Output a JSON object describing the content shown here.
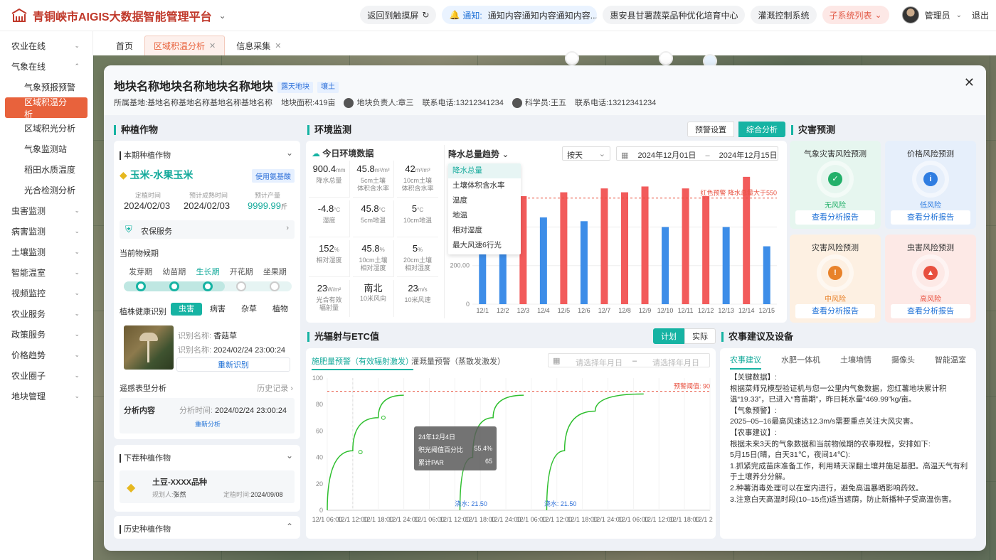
{
  "header": {
    "app_title": "青铜峡市AIGIS大数据智能管理平台",
    "back_label": "返回到触摸屏",
    "notice_label": "通知:",
    "notice_text": "通知内容通知内容通知内容...",
    "org": "惠安县甘薯蔬菜品种优化培育中心",
    "irrigation": "灌溉控制系统",
    "subsystem": "子系统列表",
    "user": "管理员",
    "logout": "退出"
  },
  "sidebar": {
    "items": [
      {
        "label": "农业在线",
        "chev": "⌄"
      },
      {
        "label": "气象在线",
        "chev": "⌃"
      },
      {
        "label": "气象预报预警",
        "sub": true
      },
      {
        "label": "区域积温分析",
        "sub": true,
        "active": true
      },
      {
        "label": "区域积光分析",
        "sub": true
      },
      {
        "label": "气象监测站",
        "sub": true
      },
      {
        "label": "稻田水质温度",
        "sub": true
      },
      {
        "label": "光合检测分析",
        "sub": true
      },
      {
        "label": "虫害监测",
        "chev": "⌄"
      },
      {
        "label": "病害监测",
        "chev": "⌄"
      },
      {
        "label": "土壤监测",
        "chev": "⌄"
      },
      {
        "label": "智能温室",
        "chev": "⌄"
      },
      {
        "label": "视频监控",
        "chev": "⌄"
      },
      {
        "label": "农业服务",
        "chev": "⌄"
      },
      {
        "label": "政策服务",
        "chev": "⌄"
      },
      {
        "label": "价格趋势",
        "chev": "⌄"
      },
      {
        "label": "农业圈子",
        "chev": "⌄"
      },
      {
        "label": "地块管理",
        "chev": "⌄"
      }
    ]
  },
  "tabs": [
    {
      "label": "首页"
    },
    {
      "label": "区域积温分析",
      "active": true,
      "close": "✕"
    },
    {
      "label": "信息采集",
      "close": "✕"
    }
  ],
  "modal": {
    "title": "地块名称地块名称地块名称地块",
    "tag1": "露天地块",
    "tag2": "壤土",
    "base_label": "所属基地:",
    "base_value": "基地名称基地名称基地名称基地名称",
    "area_label": "地块面积:",
    "area_value": "419亩",
    "owner_label": "地块负责人:",
    "owner_value": "章三",
    "phone_label": "联系电话:",
    "phone_value": "13212341234",
    "sci_label": "科学员:",
    "sci_value": "王五",
    "phone2_label": "联系电话:",
    "phone2_value": "13212341234",
    "close": "✕"
  },
  "crop": {
    "section": "种植作物",
    "current_title": "本期种植作物",
    "name": "玉米-水果玉米",
    "fert_btn": "使用氨基酸",
    "plant_time_label": "定植时间",
    "plant_time": "2024/02/03",
    "harvest_label": "预计成熟时间",
    "harvest": "2024/02/03",
    "yield_label": "预计产量",
    "yield": "9999.99",
    "yield_unit": "斤",
    "service": "农保服务",
    "phenology_title": "当前物候期",
    "phases": [
      "发芽期",
      "幼苗期",
      "生长期",
      "开花期",
      "坐果期"
    ],
    "current_phase_index": 2,
    "health_title": "植株健康识别",
    "health_tabs": [
      "虫害",
      "病害",
      "杂草",
      "植物"
    ],
    "id_name_label": "识别名称:",
    "id_name": "香菇草",
    "id_time_label": "识别名称:",
    "id_time": "2024/02/24 23:00:24",
    "reidentify": "重新识别",
    "remote_title": "遥感表型分析",
    "history": "历史记录",
    "analysis_label": "分析内容",
    "analysis_time_label": "分析时间:",
    "analysis_time": "2024/02/24 23:00:24",
    "reanalyze": "重新分析",
    "next_title": "下茬种植作物",
    "next_name": "土豆-XXXX品种",
    "planner_label": "规划人:",
    "planner": "张然",
    "next_time_label": "定植时间:",
    "next_time": "2024/09/08",
    "history_title": "历史种植作物"
  },
  "env": {
    "section": "环境监测",
    "warn_btn": "预警设置",
    "analysis_btn": "综合分析",
    "today": "今日环境数据",
    "cells": [
      {
        "v": "900.4",
        "u": "mm",
        "l1": "降水总量",
        "l2": ""
      },
      {
        "v": "45.8",
        "u": "m³/m³",
        "l1": "5cm土壤",
        "l2": "体积含水率"
      },
      {
        "v": "42",
        "u": "m³/m³",
        "l1": "10cm土壤",
        "l2": "体积含水率"
      },
      {
        "v": "-4.8",
        "u": "°C",
        "l1": "湿度",
        "l2": ""
      },
      {
        "v": "45.8",
        "u": "°C",
        "l1": "5cm地温",
        "l2": ""
      },
      {
        "v": "5",
        "u": "°C",
        "l1": "10cm地温",
        "l2": ""
      },
      {
        "v": "152",
        "u": "%",
        "l1": "相对湿度",
        "l2": ""
      },
      {
        "v": "45.8",
        "u": "%",
        "l1": "10cm土壤",
        "l2": "相对湿度"
      },
      {
        "v": "5",
        "u": "%",
        "l1": "20cm土壤",
        "l2": "相对湿度"
      },
      {
        "v": "23",
        "u": "W/m²",
        "l1": "光合有效",
        "l2": "辐射量"
      },
      {
        "v": "南北",
        "u": "",
        "l1": "10米风向",
        "l2": ""
      },
      {
        "v": "23",
        "u": "m/s",
        "l1": "10米风速",
        "l2": ""
      }
    ],
    "trend_title": "降水总量趋势",
    "period": "按天",
    "date_from": "2024年12月01日",
    "date_sep": "–",
    "date_to": "2024年12月15日",
    "dropdown": [
      "降水总量",
      "土壤体积含水率",
      "温度",
      "地温",
      "相对湿度",
      "最大风速6行光"
    ]
  },
  "chart_data": [
    {
      "type": "bar",
      "categories": [
        "12/1",
        "12/2",
        "12/3",
        "12/4",
        "12/5",
        "12/6",
        "12/7",
        "12/8",
        "12/9",
        "12/10",
        "12/11",
        "12/12",
        "12/13",
        "12/14",
        "12/15"
      ],
      "values": [
        410,
        410,
        560,
        450,
        580,
        430,
        600,
        580,
        610,
        400,
        600,
        560,
        400,
        660,
        300
      ],
      "colors": [
        "#3d8de8",
        "#3d8de8",
        "#f25b5b",
        "#3d8de8",
        "#f25b5b",
        "#3d8de8",
        "#f25b5b",
        "#f25b5b",
        "#f25b5b",
        "#3d8de8",
        "#f25b5b",
        "#f25b5b",
        "#3d8de8",
        "#f25b5b",
        "#3d8de8"
      ],
      "yticks": [
        "0",
        "200.00",
        "400.00"
      ],
      "ylim": [
        0,
        700
      ],
      "threshold": 550,
      "threshold_label": "红色预警 降水总量大于550"
    },
    {
      "type": "line",
      "series": [
        {
          "points": [
            [
              0,
              0
            ],
            [
              1,
              45
            ],
            [
              2,
              70
            ],
            [
              3,
              87
            ]
          ]
        },
        {
          "points": [
            [
              5.2,
              0
            ],
            [
              5.7,
              40
            ],
            [
              6.5,
              70
            ],
            [
              7.7,
              87
            ]
          ]
        },
        {
          "points": [
            [
              8.6,
              0
            ],
            [
              9.3,
              45
            ],
            [
              10.5,
              75
            ],
            [
              12.4,
              88
            ]
          ]
        }
      ],
      "markers": [
        [
          1.3,
          44
        ],
        [
          2.2,
          70
        ]
      ],
      "xticks": [
        "12/1 06:00",
        "12/1 12:00",
        "12/1 18:00",
        "12/1 24:00",
        "12/1 06:00",
        "12/1 12:00",
        "12/1 18:00",
        "12/1 24:00",
        "12/1 06:00",
        "12/1 12:00",
        "12/1 18:00",
        "12/1 24:00",
        "12/1 06:00",
        "12/1 12:00",
        "12/1 18:00",
        "12/1 24:00"
      ],
      "yticks": [
        "0",
        "20",
        "40",
        "60",
        "80",
        "100"
      ],
      "ylim": [
        0,
        100
      ],
      "threshold": 90,
      "threshold_label": "预警阈值: 90",
      "irrigation_labels": [
        "浇水: 21.50",
        "浇水: 21.50"
      ],
      "irrigation_x": [
        5.0,
        8.5
      ]
    }
  ],
  "radiation": {
    "section": "光辐射与ETC值",
    "plan": "计划",
    "actual": "实际",
    "tab1": "施肥量预警（有效辐射激发）",
    "tab2": "灌溉量预警（蒸散发激发）",
    "start_ph": "请选择年月日",
    "end_ph": "请选择年月日",
    "tooltip_date": "24年12月4日",
    "tooltip_k1": "积光阈值百分比",
    "tooltip_v1": "55.4%",
    "tooltip_k2": "累计PAR",
    "tooltip_v2": "65"
  },
  "disaster": {
    "section": "灾害预测",
    "cards": [
      {
        "title": "气象灾害风险预测",
        "level": "无风险",
        "btn": "查看分析报告",
        "color": "#23b06a",
        "bg": "#e6f6ef",
        "icon": "✓"
      },
      {
        "title": "价格风险预测",
        "level": "低风险",
        "btn": "查看分析报告",
        "color": "#2f7de1",
        "bg": "#e6effb",
        "icon": "i"
      },
      {
        "title": "灾害风险预测",
        "level": "中风险",
        "btn": "查看分析报告",
        "color": "#e8822a",
        "bg": "#fdf0e2",
        "icon": "!"
      },
      {
        "title": "虫害风险预测",
        "level": "高风险",
        "btn": "查看分析报告",
        "color": "#e8503f",
        "bg": "#fde9e6",
        "icon": "▲"
      }
    ]
  },
  "advice": {
    "section": "农事建议及设备",
    "tabs": [
      "农事建议",
      "水肥一体机",
      "土壤墒情",
      "摄像头",
      "智能温室"
    ],
    "lines": [
      "【关键数据】:",
      "根据菜师兄模型验证机与您一公里内气象数据，您红薯地块累计积温“19.33”，已进入“育苗期”，昨日耗水量“469.99”kg/亩。",
      "【气象预警】:",
      "2025–05–16最高风速达12.3m/s需要重点关注大风灾害。",
      "【农事建议】:",
      "根据未来3天的气象数据和当前物候期的农事规程，安排如下:",
      "5月15日(晴，白天31℃，夜间14℃):",
      "1.抓紧完成苗床准备工作，利用晴天深翻土壤并施足基肥。高温天气有利于土壤养分分解。",
      "2.种薯消毒处理可以在室内进行，避免高温暴晒影响药效。",
      "3.注意白天高温时段(10–15点)适当遮荫，防止新播种子受高温伤害。"
    ]
  }
}
